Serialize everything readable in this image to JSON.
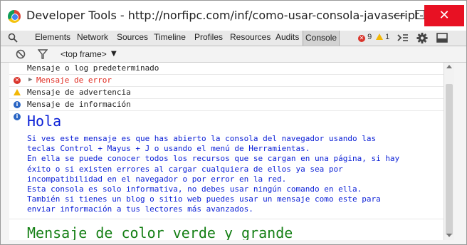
{
  "window": {
    "title": "Developer Tools - http://norfipc.com/inf/como-usar-consola-javascript-na...",
    "buttons": {
      "minimize": "—",
      "maximize": "☐",
      "close": "✕"
    }
  },
  "toolbar": {
    "tabs": [
      "Elements",
      "Network",
      "Sources",
      "Timeline",
      "Profiles",
      "Resources",
      "Audits",
      "Console"
    ],
    "active_tab": "Console",
    "error_count": "9",
    "warning_count": "1",
    "icons": [
      "search-icon",
      "console-drawer-icon",
      "gear-icon",
      "dock-icon"
    ]
  },
  "filter": {
    "frame_label": "<top frame>",
    "icons": [
      "clear-icon",
      "filter-icon"
    ]
  },
  "console": {
    "messages": [
      {
        "type": "log",
        "text": "Mensaje o log predeterminado"
      },
      {
        "type": "error",
        "text": "Mensaje de error"
      },
      {
        "type": "warning",
        "text": "Mensaje de advertencia"
      },
      {
        "type": "info",
        "text": "Mensaje de información"
      }
    ],
    "styled": {
      "heading": "Hola",
      "body_lines": [
        "Si ves este mensaje es que has abierto la consola del navegador usando las",
        "teclas Control + Mayus + J o usando el menú de Herramientas.",
        "En ella se puede conocer todos los recursos que se cargan en una página, si hay",
        "éxito o si existen errores al cargar cualquiera de ellos ya sea por",
        "incompatibilidad en el navegador o por error en la red.",
        "Esta consola es solo informativa, no debes usar ningún comando en ella.",
        "También si tienes un blog o sitio web puedes usar un mensaje como este para",
        "enviar información a tus lectores más avanzados."
      ],
      "green_message": "Mensaje de color verde y grande"
    },
    "colors": {
      "error": "#e02b20",
      "info_text": "#0a1fd6",
      "green_text": "#147f14"
    }
  }
}
